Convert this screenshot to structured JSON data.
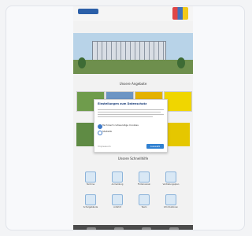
{
  "topbar": {
    "logo_text": ""
  },
  "navigation": {
    "items": [
      "Startseite",
      "Aktuelles",
      "Schule",
      "Service",
      "Kontakt"
    ]
  },
  "sections": {
    "hero_title": "",
    "main_title": "Unsere Angebote",
    "cookie_title": "Einstellungen zum Datenschutz",
    "cookie_text": "",
    "icons_title": "Unsere Schnellhilfe"
  },
  "cookie_modal": {
    "option_1": "Technisch notwendige Cookies",
    "option_2": "Statistik",
    "button_label": "Auswahl speichern",
    "link_label": "Impressum"
  },
  "icons": [
    {
      "name": "calendar",
      "label": "Termine"
    },
    {
      "name": "document",
      "label": "Anmeldung"
    },
    {
      "name": "heart",
      "label": "Förderverein"
    },
    {
      "name": "clipboard",
      "label": "Vertretungsplan"
    },
    {
      "name": "building",
      "label": "Schulgebäude"
    },
    {
      "name": "map",
      "label": "Anfahrt"
    },
    {
      "name": "people",
      "label": "Team"
    },
    {
      "name": "info",
      "label": "Informationen"
    }
  ],
  "colors": {
    "primary": "#2f80d1",
    "title": "#1c3f7b",
    "footer": "#4b4b4b"
  }
}
